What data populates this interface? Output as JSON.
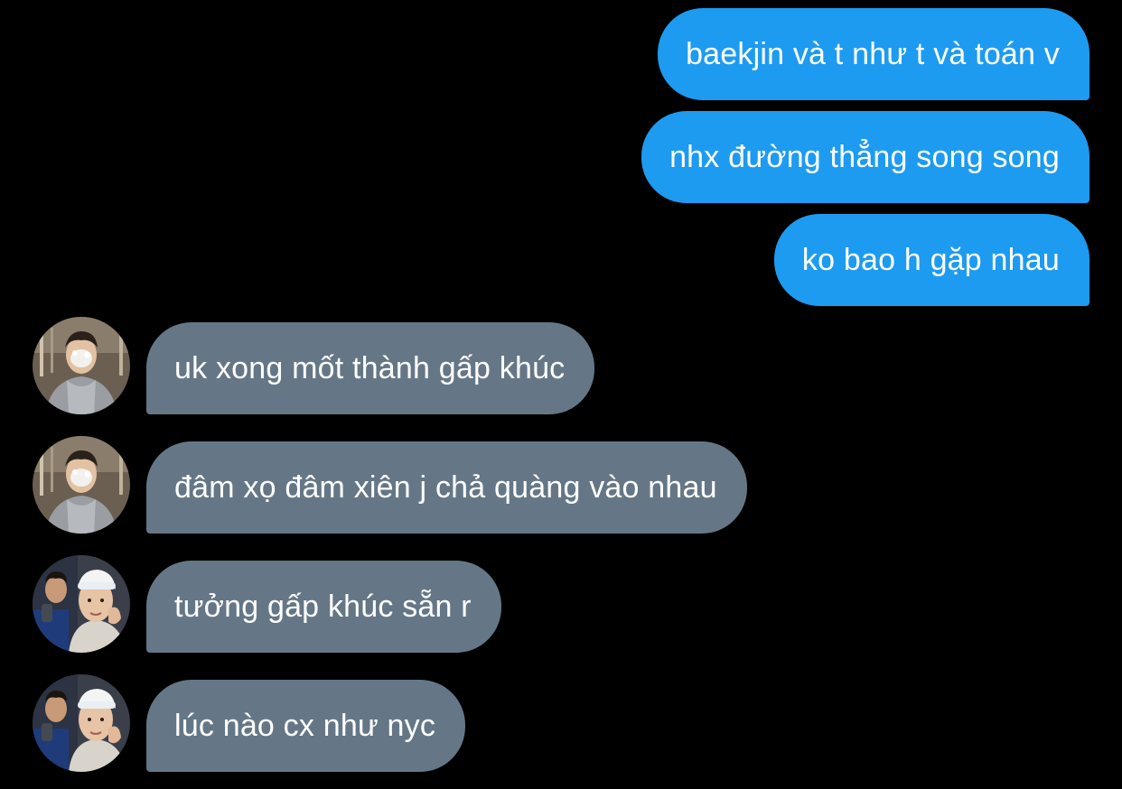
{
  "messages": [
    {
      "direction": "out",
      "text": "baekjin và t như t và toán v"
    },
    {
      "direction": "out",
      "text": "nhx đường thẳng song song"
    },
    {
      "direction": "out",
      "text": "ko bao h gặp nhau"
    },
    {
      "direction": "in",
      "avatar": "avatar-hoodie-boy",
      "text": "uk xong mốt thành gấp khúc"
    },
    {
      "direction": "in",
      "avatar": "avatar-hoodie-boy",
      "text": "đâm xọ đâm xiên j chả quàng vào nhau"
    },
    {
      "direction": "in",
      "avatar": "avatar-headband-boy",
      "text": "tưởng gấp khúc sẵn r"
    },
    {
      "direction": "in",
      "avatar": "avatar-headband-boy",
      "text": "lúc nào cx như nyc"
    }
  ],
  "colors": {
    "background": "#000000",
    "outgoing_bubble": "#1d9bf0",
    "incoming_bubble": "#657786",
    "text": "#ffffff"
  }
}
